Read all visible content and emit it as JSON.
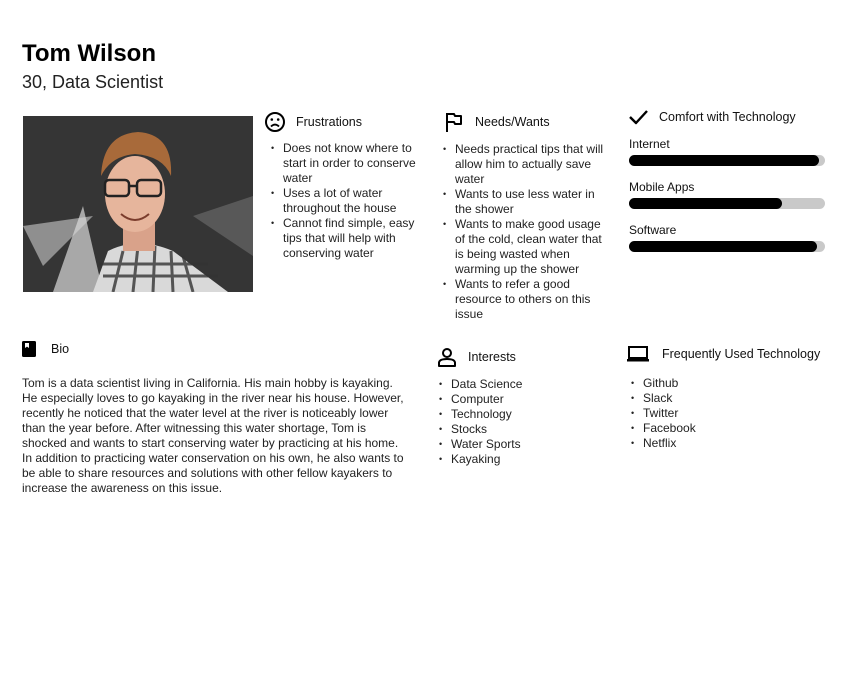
{
  "persona": {
    "name": "Tom Wilson",
    "subtitle": "30, Data Scientist"
  },
  "photo": {
    "icon": "profile-photo"
  },
  "frustrations": {
    "title": "Frustrations",
    "icon": "sad-face-icon",
    "items": [
      "Does not know where to start in order to conserve water",
      "Uses a lot of water throughout the house",
      "Cannot find simple, easy tips that will help with conserving water"
    ]
  },
  "needs": {
    "title": "Needs/Wants",
    "icon": "flag-icon",
    "items": [
      "Needs practical tips that will allow him to actually save water",
      "Wants to use less water in the shower",
      "Wants to make good usage of the cold, clean water that is being wasted when warming up the shower",
      "Wants to refer a good resource to others on this issue"
    ]
  },
  "comfort": {
    "title": "Comfort with Technology",
    "icon": "check-icon",
    "bars": [
      {
        "label": "Internet",
        "level": 0.97
      },
      {
        "label": "Mobile Apps",
        "level": 0.78
      },
      {
        "label": "Software",
        "level": 0.96
      }
    ]
  },
  "bio": {
    "title": "Bio",
    "icon": "book-icon",
    "text": "Tom is a data scientist living in California. His main hobby is kayaking. He especially loves to go kayaking in the river near his house. However, recently he noticed that the water level at the river is noticeably lower than the year before. After witnessing this water shortage, Tom is shocked and wants to start conserving water by practicing at his home. In addition to practicing water conservation on his own, he also wants to be able to share resources and solutions with other fellow kayakers to increase the awareness on this issue."
  },
  "interests": {
    "title": "Interests",
    "icon": "person-icon",
    "items": [
      "Data Science",
      "Computer",
      "Technology",
      "Stocks",
      "Water Sports",
      "Kayaking"
    ]
  },
  "tech": {
    "title": "Frequently Used Technology",
    "icon": "laptop-icon",
    "items": [
      "Github",
      "Slack",
      "Twitter",
      "Facebook",
      "Netflix"
    ]
  }
}
